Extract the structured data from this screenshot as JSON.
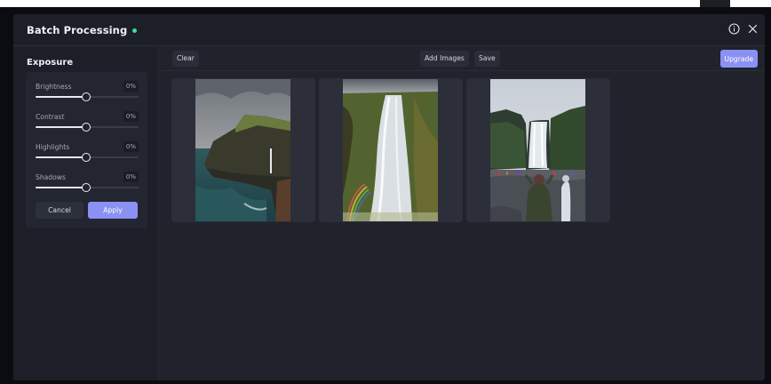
{
  "window": {
    "title": "Batch Processing",
    "status_color": "#3fdc9a"
  },
  "titlebar_icons": [
    "info-icon",
    "close-icon"
  ],
  "sidebar": {
    "heading": "Exposure",
    "controls": [
      {
        "label": "Brightness",
        "value": "0%"
      },
      {
        "label": "Contrast",
        "value": "0%"
      },
      {
        "label": "Highlights",
        "value": "0%"
      },
      {
        "label": "Shadows",
        "value": "0%"
      }
    ],
    "cancel_label": "Cancel",
    "apply_label": "Apply"
  },
  "toolbar": {
    "clear_label": "Clear",
    "add_images_label": "Add Images",
    "save_label": "Save",
    "upgrade_label": "Upgrade"
  },
  "images": [
    {
      "subject": "coastal cliff with waterfall"
    },
    {
      "subject": "waterfall with rainbow"
    },
    {
      "subject": "waterfall with visitors"
    }
  ],
  "colors": {
    "accent": "#8a91f3",
    "background": "#20222c"
  }
}
